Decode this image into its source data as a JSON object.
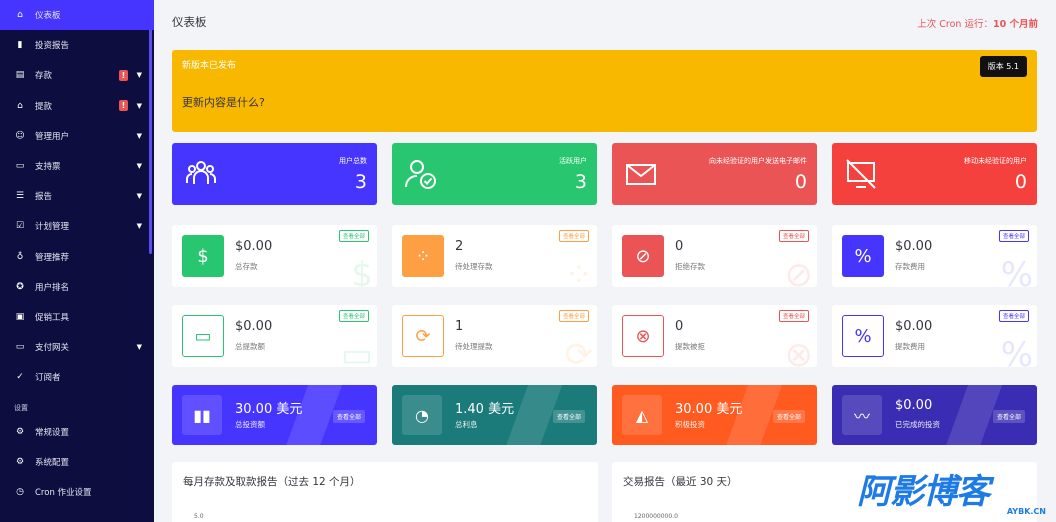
{
  "sidebar": {
    "items": [
      {
        "label": "仪表板",
        "icon": "home-icon",
        "active": true
      },
      {
        "label": "投资报告",
        "icon": "bar-chart-icon"
      },
      {
        "label": "存款",
        "icon": "deposit-icon",
        "alert": "!",
        "chevron": true
      },
      {
        "label": "提款",
        "icon": "bank-icon",
        "alert": "!",
        "chevron": true
      },
      {
        "label": "管理用户",
        "icon": "users-icon",
        "chevron": true
      },
      {
        "label": "支持票",
        "icon": "ticket-icon",
        "chevron": true
      },
      {
        "label": "报告",
        "icon": "list-icon",
        "chevron": true
      },
      {
        "label": "计划管理",
        "icon": "clipboard-icon",
        "chevron": true
      },
      {
        "label": "管理推荐",
        "icon": "referral-icon"
      },
      {
        "label": "用户排名",
        "icon": "medal-icon"
      },
      {
        "label": "促销工具",
        "icon": "promo-icon"
      },
      {
        "label": "支付网关",
        "icon": "credit-card-icon",
        "chevron": true
      },
      {
        "label": "订阅者",
        "icon": "thumbs-up-icon"
      }
    ],
    "section": "设置",
    "settings_items": [
      {
        "label": "常规设置",
        "icon": "gear-icon"
      },
      {
        "label": "系统配置",
        "icon": "cog-icon"
      },
      {
        "label": "Cron 作业设置",
        "icon": "clock-icon"
      }
    ]
  },
  "header": {
    "title": "仪表板",
    "cron_prefix": "上次 Cron 运行：",
    "cron_value": "10 个月前"
  },
  "alert": {
    "title": "新版本已发布",
    "question": "更新内容是什么?",
    "version_button": "版本 5.1"
  },
  "stats": [
    {
      "label": "用户总数",
      "value": "3",
      "color": "#4634ff",
      "icon": "users-group-icon"
    },
    {
      "label": "活跃用户",
      "value": "3",
      "color": "#28c76f",
      "icon": "user-check-icon"
    },
    {
      "label": "向未经验证的用户发送电子邮件",
      "value": "0",
      "color": "#ea5455",
      "icon": "envelope-icon"
    },
    {
      "label": "移动未经验证的用户",
      "value": "0",
      "color": "#f5413d",
      "icon": "mobile-off-icon"
    }
  ],
  "deposit_cards": [
    {
      "value": "$0.00",
      "label": "总存款",
      "color": "#28c76f",
      "icon": "hand-dollar-icon",
      "view": "查看全部",
      "outline": false
    },
    {
      "value": "2",
      "label": "待处理存款",
      "color": "#ff9f43",
      "icon": "spinner-icon",
      "view": "查看全部",
      "outline": false
    },
    {
      "value": "0",
      "label": "拒绝存款",
      "color": "#ea5455",
      "icon": "ban-icon",
      "view": "查看全部",
      "outline": false
    },
    {
      "value": "$0.00",
      "label": "存款费用",
      "color": "#4634ff",
      "icon": "percent-icon",
      "view": "查看全部",
      "outline": false
    }
  ],
  "withdraw_cards": [
    {
      "value": "$0.00",
      "label": "总提款额",
      "color": "#28c76f",
      "icon": "card-icon",
      "view": "查看全部"
    },
    {
      "value": "1",
      "label": "待处理提款",
      "color": "#ff9f43",
      "icon": "refresh-icon",
      "view": "查看全部"
    },
    {
      "value": "0",
      "label": "提款被拒",
      "color": "#ea5455",
      "icon": "x-circle-icon",
      "view": "查看全部"
    },
    {
      "value": "$0.00",
      "label": "提款费用",
      "color": "#4634ff",
      "icon": "percent-icon",
      "view": "查看全部"
    }
  ],
  "invest_cards": [
    {
      "value": "30.00 美元",
      "label": "总投资额",
      "color": "#4634ff",
      "icon": "bars-icon",
      "view": "查看全部"
    },
    {
      "value": "1.40 美元",
      "label": "总利息",
      "color": "#1b7a7a",
      "icon": "pie-icon",
      "view": "查看全部"
    },
    {
      "value": "30.00 美元",
      "label": "积极投资",
      "color": "#ff5a1f",
      "icon": "area-chart-icon",
      "view": "查看全部"
    },
    {
      "value": "$0.00",
      "label": "已完成的投资",
      "color": "#3b2db3",
      "icon": "trend-icon",
      "view": "查看全部"
    }
  ],
  "panels": [
    {
      "title": "每月存款及取款报告（过去 12 个月）",
      "axis": "5.0"
    },
    {
      "title": "交易报告（最近 30 天）",
      "axis": "1200000000.0"
    }
  ],
  "watermark": {
    "big": "阿影博客",
    "small": "AYBK.CN"
  }
}
